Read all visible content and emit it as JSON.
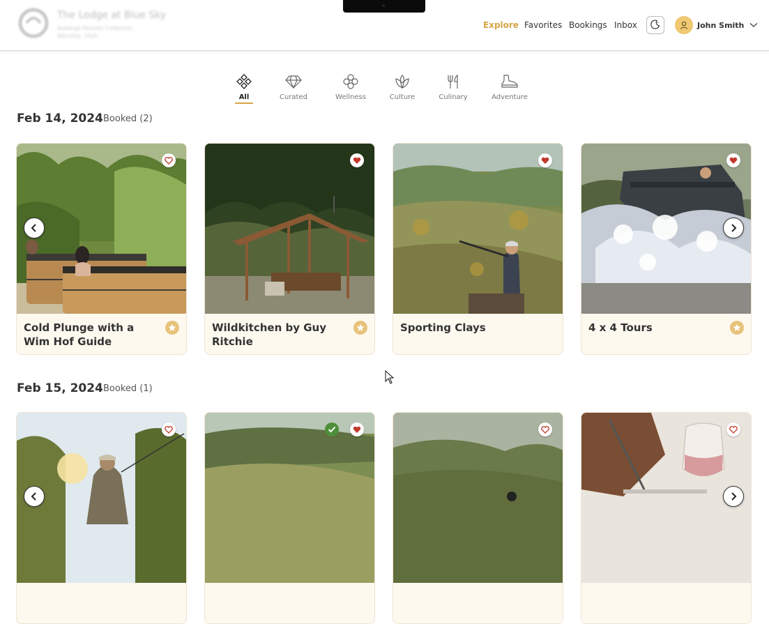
{
  "header": {
    "brand_name": "The Lodge at Blue Sky",
    "brand_sub_1": "Auberge Resorts Collection",
    "brand_sub_2": "Wanship, Utah",
    "nav": [
      {
        "label": "Explore",
        "active": true
      },
      {
        "label": "Favorites",
        "active": false
      },
      {
        "label": "Bookings",
        "active": false
      },
      {
        "label": "Inbox",
        "active": false
      }
    ],
    "user_name": "John Smith",
    "accent": "#d4a545"
  },
  "categories": [
    {
      "label": "All",
      "icon": "diamond-grid-icon",
      "active": true
    },
    {
      "label": "Curated",
      "icon": "gem-icon",
      "active": false
    },
    {
      "label": "Wellness",
      "icon": "wellness-flower-icon",
      "active": false
    },
    {
      "label": "Culture",
      "icon": "lotus-icon",
      "active": false
    },
    {
      "label": "Culinary",
      "icon": "fork-knife-icon",
      "active": false
    },
    {
      "label": "Adventure",
      "icon": "boot-icon",
      "active": false
    }
  ],
  "days": [
    {
      "date": "Feb 14, 2024",
      "badge": "Booked (2)",
      "cards": [
        {
          "title": "Cold Plunge with a Wim Hof Guide",
          "favorited": false,
          "booked": false,
          "curated": true
        },
        {
          "title": "Wildkitchen by Guy Ritchie",
          "favorited": true,
          "booked": false,
          "curated": true
        },
        {
          "title": "Sporting Clays",
          "favorited": true,
          "booked": false,
          "curated": false
        },
        {
          "title": "4 x 4 Tours",
          "favorited": true,
          "booked": false,
          "curated": true
        }
      ]
    },
    {
      "date": "Feb 15, 2024",
      "badge": "Booked (1)",
      "cards": [
        {
          "title": "",
          "favorited": false,
          "booked": false
        },
        {
          "title": "",
          "favorited": true,
          "booked": true
        },
        {
          "title": "",
          "favorited": false,
          "booked": false
        },
        {
          "title": "",
          "favorited": false,
          "booked": false
        }
      ]
    }
  ]
}
